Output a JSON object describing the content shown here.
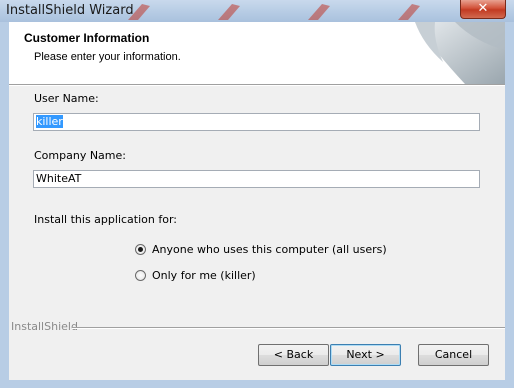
{
  "window": {
    "title": "InstallShield Wizard",
    "close_glyph": "✕",
    "accent_frame": "#b8cde5"
  },
  "header": {
    "title": "Customer Information",
    "subtitle": "Please enter your information."
  },
  "form": {
    "user_name_label": "User Name:",
    "user_name_value": "killer",
    "company_name_label": "Company Name:",
    "company_name_value": "WhiteAT",
    "install_for_label": "Install this application for:",
    "options": [
      {
        "label": "Anyone who uses this computer (all users)",
        "selected": true
      },
      {
        "label": "Only for me (killer)",
        "selected": false
      }
    ]
  },
  "footer": {
    "brand": "InstallShield",
    "back_label": "< Back",
    "next_label": "Next >",
    "cancel_label": "Cancel"
  }
}
